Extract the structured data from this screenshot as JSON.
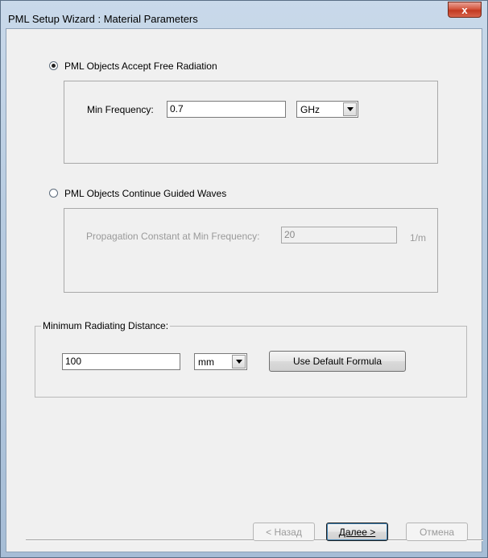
{
  "window": {
    "title": "PML Setup Wizard : Material Parameters",
    "close_label": "x"
  },
  "option_free_radiation": {
    "label": "PML Objects Accept Free Radiation",
    "selected": true,
    "min_frequency_label": "Min Frequency:",
    "min_frequency_value": "0.7",
    "unit_value": "GHz"
  },
  "option_guided_waves": {
    "label": "PML Objects Continue Guided Waves",
    "selected": false,
    "propagation_label": "Propagation Constant at Min Frequency:",
    "propagation_value": "20",
    "propagation_unit": "1/m"
  },
  "min_radiating_distance": {
    "legend": "Minimum Radiating Distance:",
    "value": "100",
    "unit_value": "mm",
    "default_formula_label": "Use Default Formula"
  },
  "footer": {
    "back_label": "< Назад",
    "next_label": "Далее >",
    "cancel_label": "Отмена"
  }
}
